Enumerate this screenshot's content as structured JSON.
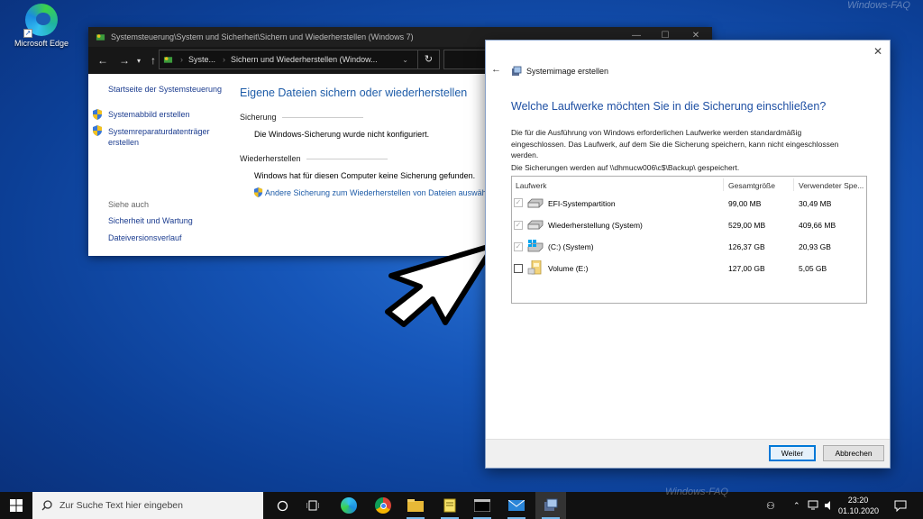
{
  "desktop": {
    "edge_label": "Microsoft Edge",
    "watermark_top": "Windows-FAQ",
    "watermark_bottom": "Windows-FAQ"
  },
  "control_panel": {
    "title": "Systemsteuerung\\System und Sicherheit\\Sichern und Wiederherstellen (Windows 7)",
    "address_short": "Syste...",
    "address_current": "Sichern und Wiederherstellen (Window...",
    "sidebar": {
      "home": "Startseite der Systemsteuerung",
      "create_image": "Systemabbild erstellen",
      "repair_disc_line1": "Systemreparaturdatenträger",
      "repair_disc_line2": "erstellen",
      "see_also": "Siehe auch",
      "security": "Sicherheit und Wartung",
      "file_history": "Dateiversionsverlauf"
    },
    "main": {
      "heading": "Eigene Dateien sichern oder wiederherstellen",
      "backup_section": "Sicherung",
      "backup_status": "Die Windows-Sicherung wurde nicht konfiguriert.",
      "restore_section": "Wiederherstellen",
      "restore_status": "Windows hat für diesen Computer keine Sicherung gefunden.",
      "restore_link": "Andere Sicherung zum Wiederherstellen von Dateien auswähl"
    }
  },
  "dialog": {
    "title": "Systemimage erstellen",
    "heading": "Welche Laufwerke möchten Sie in die Sicherung einschließen?",
    "desc_line1": "Die für die Ausführung von Windows erforderlichen Laufwerke werden standardmäßig",
    "desc_line2": "eingeschlossen. Das Laufwerk, auf dem Sie die Sicherung speichern, kann nicht eingeschlossen",
    "desc_line3": "werden.",
    "path_text": "Die Sicherungen werden auf \\\\dhmucw006\\c$\\Backup\\ gespeichert.",
    "columns": [
      "Laufwerk",
      "Gesamtgröße",
      "Verwendeter Spe..."
    ],
    "drives": [
      {
        "name": "EFI-Systempartition",
        "total": "99,00 MB",
        "used": "30,49 MB",
        "checked": true,
        "disabled": true,
        "icon": "drive-icon"
      },
      {
        "name": "Wiederherstellung (System)",
        "total": "529,00 MB",
        "used": "409,66 MB",
        "checked": true,
        "disabled": true,
        "icon": "drive-icon"
      },
      {
        "name": "(C:) (System)",
        "total": "126,37 GB",
        "used": "20,93 GB",
        "checked": true,
        "disabled": true,
        "icon": "windows-drive-icon"
      },
      {
        "name": "Volume (E:)",
        "total": "127,00 GB",
        "used": "5,05 GB",
        "checked": false,
        "disabled": false,
        "icon": "volume-drive-icon"
      }
    ],
    "next_button": "Weiter",
    "cancel_button": "Abbrechen"
  },
  "taskbar": {
    "search_placeholder": "Zur Suche Text hier eingeben",
    "time": "23:20",
    "date": "01.10.2020"
  },
  "colors": {
    "accent": "#0078d7",
    "link": "#1e5ca8",
    "desktop": "#1656b9"
  }
}
